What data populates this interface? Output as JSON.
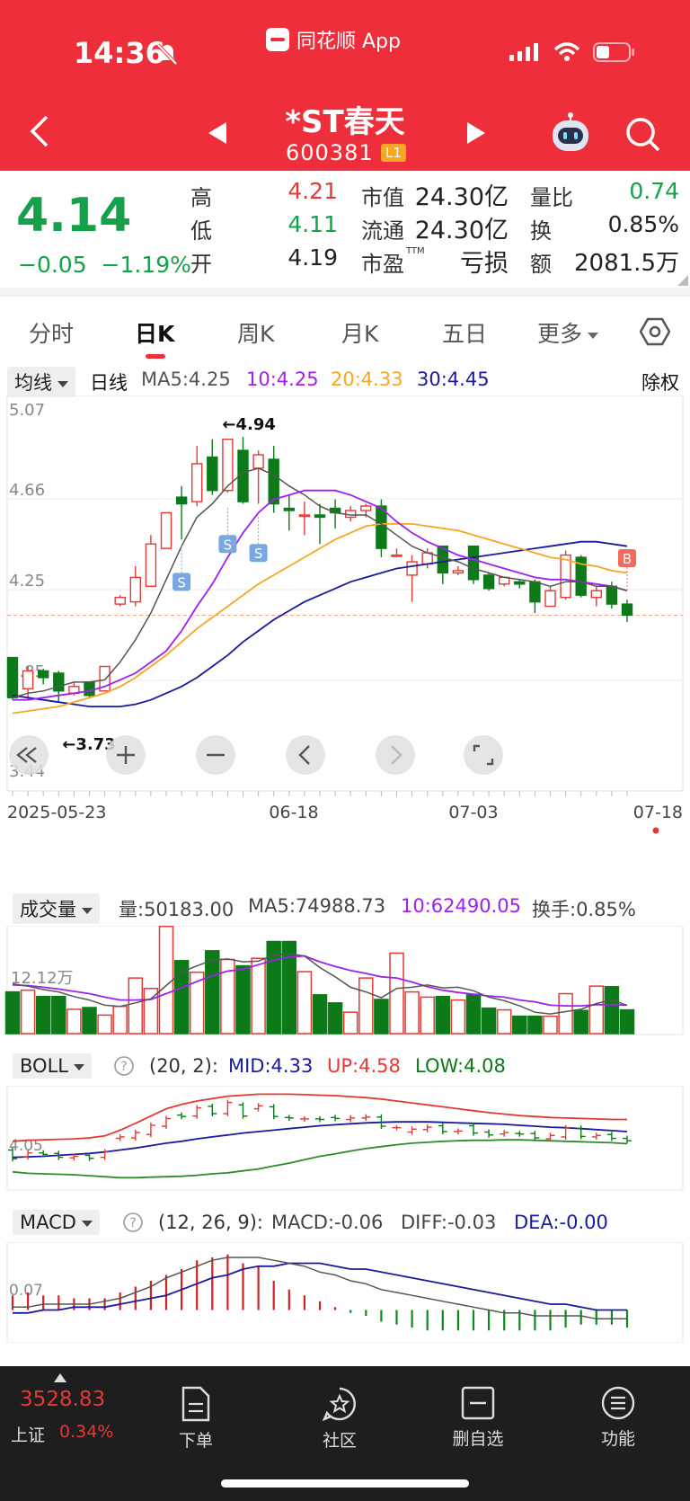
{
  "status": {
    "time": "14:36",
    "app_name": "同花顺 App"
  },
  "stock": {
    "name": "*ST春天",
    "code": "600381",
    "level": "L1"
  },
  "quote": {
    "price": "4.14",
    "change": "−0.05",
    "change_pct": "−1.19%",
    "high_label": "高",
    "high": "4.21",
    "low_label": "低",
    "low": "4.11",
    "open_label": "开",
    "open": "4.19",
    "mcap_label": "市值",
    "mcap": "24.30亿",
    "float_label": "流通",
    "float": "24.30亿",
    "pe_label": "市盈",
    "pe_sup": "TTM",
    "pe": "亏损",
    "vr_label": "量比",
    "vr": "0.74",
    "turnover_label": "换",
    "turnover": "0.85%",
    "amount_label": "额",
    "amount": "2081.5万"
  },
  "tabs": [
    "分时",
    "日K",
    "周K",
    "月K",
    "五日",
    "更多"
  ],
  "ma": {
    "dropdown": "均线",
    "period": "日线",
    "ma5": "MA5:4.25",
    "ma10": "10:4.25",
    "ma20": "20:4.33",
    "ma30": "30:4.45",
    "adjust": "除权"
  },
  "colors": {
    "up": "#e53935",
    "down": "#0c7a18",
    "ma5": "#555555",
    "ma10": "#a020f0",
    "ma20": "#f6a623",
    "ma30": "#1a1a9c",
    "header": "#ee2f3b"
  },
  "chart_data": [
    {
      "type": "candlestick",
      "ylim": [
        3.44,
        5.07
      ],
      "y_ticks": [
        "5.07",
        "4.66",
        "4.25",
        "3.85",
        "3.44"
      ],
      "x_ticks": [
        "2025-05-23",
        "06-18",
        "07-03",
        "07-18"
      ],
      "annotations": {
        "high": "←4.94",
        "low": "←3.73",
        "sell_marker": "S",
        "buy_marker": "B"
      },
      "candles": [
        [
          3.95,
          3.77,
          3.95,
          3.76
        ],
        [
          3.81,
          3.89,
          3.91,
          3.76
        ],
        [
          3.89,
          3.86,
          3.9,
          3.83
        ],
        [
          3.88,
          3.8,
          3.89,
          3.75
        ],
        [
          3.79,
          3.82,
          3.84,
          3.78
        ],
        [
          3.84,
          3.78,
          3.84,
          3.77
        ],
        [
          3.8,
          3.91,
          3.91,
          3.8
        ],
        [
          4.19,
          4.22,
          4.23,
          4.18
        ],
        [
          4.2,
          4.31,
          4.36,
          4.18
        ],
        [
          4.27,
          4.46,
          4.5,
          4.27
        ],
        [
          4.44,
          4.6,
          4.6,
          4.44
        ],
        [
          4.67,
          4.64,
          4.72,
          4.48
        ],
        [
          4.65,
          4.82,
          4.9,
          4.63
        ],
        [
          4.85,
          4.7,
          4.93,
          4.68
        ],
        [
          4.7,
          4.93,
          4.93,
          4.69
        ],
        [
          4.88,
          4.65,
          4.94,
          4.64
        ],
        [
          4.8,
          4.86,
          4.88,
          4.64
        ],
        [
          4.84,
          4.64,
          4.9,
          4.6
        ],
        [
          4.62,
          4.61,
          4.68,
          4.52
        ],
        [
          4.59,
          4.59,
          4.65,
          4.5
        ],
        [
          4.59,
          4.58,
          4.64,
          4.46
        ],
        [
          4.62,
          4.6,
          4.66,
          4.53
        ],
        [
          4.58,
          4.61,
          4.63,
          4.56
        ],
        [
          4.61,
          4.63,
          4.64,
          4.58
        ],
        [
          4.63,
          4.44,
          4.66,
          4.4
        ],
        [
          4.41,
          4.41,
          4.44,
          4.4
        ],
        [
          4.32,
          4.38,
          4.41,
          4.2
        ],
        [
          4.37,
          4.42,
          4.44,
          4.35
        ],
        [
          4.45,
          4.33,
          4.45,
          4.28
        ],
        [
          4.33,
          4.34,
          4.36,
          4.32
        ],
        [
          4.45,
          4.3,
          4.45,
          4.28
        ],
        [
          4.32,
          4.26,
          4.33,
          4.25
        ],
        [
          4.28,
          4.31,
          4.31,
          4.27
        ],
        [
          4.29,
          4.28,
          4.3,
          4.26
        ],
        [
          4.29,
          4.2,
          4.3,
          4.15
        ],
        [
          4.18,
          4.25,
          4.27,
          4.18
        ],
        [
          4.22,
          4.41,
          4.43,
          4.21
        ],
        [
          4.4,
          4.23,
          4.41,
          4.22
        ],
        [
          4.22,
          4.25,
          4.27,
          4.18
        ],
        [
          4.27,
          4.19,
          4.29,
          4.17
        ],
        [
          4.19,
          4.14,
          4.21,
          4.11
        ]
      ],
      "ma5": [
        3.77,
        3.79,
        3.8,
        3.82,
        3.84,
        3.84,
        3.85,
        3.93,
        4.03,
        4.15,
        4.3,
        4.45,
        4.58,
        4.64,
        4.72,
        4.78,
        4.8,
        4.77,
        4.72,
        4.68,
        4.63,
        4.6,
        4.59,
        4.59,
        4.55,
        4.5,
        4.45,
        4.42,
        4.4,
        4.38,
        4.35,
        4.33,
        4.31,
        4.3,
        4.29,
        4.27,
        4.29,
        4.29,
        4.27,
        4.27,
        4.25
      ],
      "ma10": [
        3.76,
        3.76,
        3.77,
        3.78,
        3.79,
        3.8,
        3.82,
        3.85,
        3.88,
        3.93,
        3.98,
        4.07,
        4.18,
        4.28,
        4.4,
        4.51,
        4.6,
        4.66,
        4.68,
        4.7,
        4.7,
        4.7,
        4.68,
        4.65,
        4.62,
        4.56,
        4.51,
        4.47,
        4.44,
        4.41,
        4.39,
        4.37,
        4.35,
        4.33,
        4.31,
        4.3,
        4.3,
        4.29,
        4.28,
        4.27,
        4.25
      ],
      "ma20": [
        3.7,
        3.71,
        3.72,
        3.73,
        3.75,
        3.77,
        3.79,
        3.82,
        3.86,
        3.91,
        3.96,
        4.02,
        4.08,
        4.13,
        4.18,
        4.23,
        4.28,
        4.32,
        4.36,
        4.4,
        4.44,
        4.48,
        4.51,
        4.54,
        4.55,
        4.55,
        4.55,
        4.54,
        4.53,
        4.52,
        4.5,
        4.48,
        4.46,
        4.44,
        4.42,
        4.4,
        4.39,
        4.37,
        4.36,
        4.34,
        4.33
      ],
      "ma30": [
        3.78,
        3.77,
        3.76,
        3.75,
        3.74,
        3.73,
        3.73,
        3.73,
        3.74,
        3.76,
        3.79,
        3.82,
        3.86,
        3.91,
        3.96,
        4.02,
        4.07,
        4.12,
        4.16,
        4.2,
        4.23,
        4.26,
        4.29,
        4.31,
        4.33,
        4.35,
        4.36,
        4.37,
        4.38,
        4.39,
        4.4,
        4.41,
        4.42,
        4.43,
        4.44,
        4.45,
        4.46,
        4.47,
        4.47,
        4.46,
        4.45
      ]
    },
    {
      "type": "bar",
      "title": "成交量",
      "labels": {
        "dropdown": "成交量",
        "vol": "量:50183.00",
        "ma5": "MA5:74988.73",
        "ma10": "10:62490.05",
        "turnover": "换手:0.85%",
        "y_tick": "12.12万"
      },
      "ylim": [
        0,
        18
      ],
      "values": [
        7.2,
        7.5,
        6.4,
        6.4,
        4.2,
        4.5,
        3.2,
        4.7,
        9.6,
        7.8,
        18.5,
        12.6,
        10.6,
        14.3,
        12.8,
        11.7,
        13.0,
        15.9,
        15.9,
        10.7,
        6.7,
        5.3,
        3.7,
        9.6,
        5.9,
        13.9,
        7.2,
        6.3,
        6.4,
        5.8,
        6.8,
        4.4,
        4.1,
        3.0,
        3.0,
        3.0,
        6.9,
        4.0,
        8.2,
        8.1,
        4.1
      ],
      "ma5": [
        8.6,
        8.2,
        7.6,
        7.2,
        6.4,
        5.8,
        4.9,
        4.7,
        5.3,
        6.0,
        8.3,
        10.6,
        11.7,
        12.7,
        12.9,
        12.4,
        12.5,
        13.6,
        13.8,
        13.4,
        11.4,
        9.8,
        8.0,
        7.2,
        6.2,
        7.8,
        8.0,
        8.4,
        7.9,
        8.0,
        7.4,
        6.3,
        5.7,
        4.8,
        3.7,
        3.4,
        3.8,
        4.2,
        5.2,
        5.8,
        4.9
      ],
      "ma10": [
        8.4,
        8.3,
        8.0,
        7.7,
        7.3,
        6.9,
        6.3,
        5.8,
        5.8,
        5.9,
        6.9,
        7.9,
        9.0,
        10.0,
        10.8,
        11.1,
        11.9,
        12.7,
        13.2,
        13.4,
        12.4,
        11.6,
        10.9,
        10.4,
        9.8,
        9.6,
        8.9,
        8.1,
        7.5,
        7.1,
        6.8,
        6.5,
        6.3,
        5.8,
        5.5,
        4.9,
        4.8,
        4.8,
        5.0,
        5.0,
        4.9
      ]
    },
    {
      "type": "line",
      "title": "BOLL",
      "labels": {
        "dropdown": "BOLL",
        "params": "(20, 2):",
        "mid": "MID:4.33",
        "up": "UP:4.58",
        "low": "LOW:4.08",
        "y_tick": "4.05"
      },
      "ylim": [
        3.2,
        5.2
      ],
      "closes": [
        3.77,
        3.89,
        3.86,
        3.8,
        3.82,
        3.78,
        3.91,
        4.22,
        4.31,
        4.46,
        4.6,
        4.64,
        4.82,
        4.7,
        4.93,
        4.65,
        4.86,
        4.64,
        4.61,
        4.59,
        4.58,
        4.6,
        4.61,
        4.63,
        4.44,
        4.41,
        4.38,
        4.42,
        4.33,
        4.34,
        4.3,
        4.26,
        4.31,
        4.28,
        4.2,
        4.25,
        4.41,
        4.23,
        4.25,
        4.19,
        4.14
      ],
      "mid": [
        3.8,
        3.81,
        3.82,
        3.84,
        3.86,
        3.88,
        3.91,
        3.95,
        3.99,
        4.04,
        4.09,
        4.13,
        4.18,
        4.22,
        4.26,
        4.3,
        4.33,
        4.36,
        4.39,
        4.42,
        4.45,
        4.47,
        4.49,
        4.51,
        4.52,
        4.53,
        4.53,
        4.53,
        4.52,
        4.51,
        4.5,
        4.49,
        4.48,
        4.46,
        4.44,
        4.42,
        4.41,
        4.39,
        4.37,
        4.35,
        4.33
      ],
      "up": [
        4.13,
        4.15,
        4.16,
        4.17,
        4.18,
        4.2,
        4.24,
        4.36,
        4.5,
        4.65,
        4.8,
        4.89,
        4.96,
        5.01,
        5.06,
        5.08,
        5.1,
        5.1,
        5.1,
        5.09,
        5.08,
        5.07,
        5.05,
        5.03,
        5.0,
        4.96,
        4.92,
        4.88,
        4.84,
        4.8,
        4.76,
        4.72,
        4.69,
        4.66,
        4.64,
        4.62,
        4.61,
        4.6,
        4.59,
        4.58,
        4.58
      ],
      "low": [
        3.5,
        3.47,
        3.46,
        3.45,
        3.44,
        3.42,
        3.4,
        3.38,
        3.38,
        3.39,
        3.4,
        3.41,
        3.43,
        3.46,
        3.48,
        3.52,
        3.56,
        3.62,
        3.68,
        3.75,
        3.82,
        3.87,
        3.93,
        3.98,
        4.02,
        4.06,
        4.09,
        4.11,
        4.13,
        4.14,
        4.15,
        4.15,
        4.16,
        4.16,
        4.15,
        4.14,
        4.13,
        4.12,
        4.11,
        4.1,
        4.08
      ]
    },
    {
      "type": "bar",
      "title": "MACD",
      "labels": {
        "dropdown": "MACD",
        "params": "(12, 26, 9):",
        "macd": "MACD:-0.06",
        "diff": "DIFF:-0.03",
        "dea": "DEA:-0.00",
        "y_tick": "0.07"
      },
      "ylim": [
        -0.1,
        0.22
      ],
      "hist": [
        0.05,
        0.06,
        0.05,
        0.05,
        0.04,
        0.04,
        0.04,
        0.06,
        0.08,
        0.1,
        0.12,
        0.14,
        0.17,
        0.18,
        0.19,
        0.16,
        0.15,
        0.1,
        0.07,
        0.05,
        0.03,
        0.01,
        -0.01,
        -0.02,
        -0.04,
        -0.05,
        -0.06,
        -0.07,
        -0.07,
        -0.07,
        -0.07,
        -0.07,
        -0.07,
        -0.07,
        -0.07,
        -0.07,
        -0.06,
        -0.05,
        -0.05,
        -0.05,
        -0.06
      ],
      "diff": [
        0.01,
        0.01,
        0.02,
        0.02,
        0.02,
        0.02,
        0.03,
        0.04,
        0.06,
        0.08,
        0.11,
        0.13,
        0.15,
        0.17,
        0.18,
        0.18,
        0.18,
        0.17,
        0.16,
        0.15,
        0.13,
        0.12,
        0.1,
        0.09,
        0.07,
        0.06,
        0.05,
        0.04,
        0.03,
        0.02,
        0.01,
        0.0,
        -0.01,
        -0.01,
        -0.02,
        -0.02,
        -0.02,
        -0.02,
        -0.03,
        -0.03,
        -0.03
      ],
      "dea": [
        -0.01,
        -0.01,
        0.0,
        0.0,
        0.01,
        0.01,
        0.01,
        0.02,
        0.03,
        0.04,
        0.05,
        0.07,
        0.09,
        0.11,
        0.12,
        0.14,
        0.15,
        0.15,
        0.16,
        0.16,
        0.16,
        0.15,
        0.14,
        0.14,
        0.13,
        0.12,
        0.11,
        0.1,
        0.09,
        0.08,
        0.07,
        0.06,
        0.05,
        0.04,
        0.03,
        0.02,
        0.02,
        0.01,
        0.0,
        0.0,
        0.0
      ]
    }
  ],
  "bottom_bar": {
    "index_value": "3528.83",
    "index_name": "上证",
    "index_pct": "0.34%",
    "items": [
      "下单",
      "社区",
      "删自选",
      "功能"
    ]
  }
}
